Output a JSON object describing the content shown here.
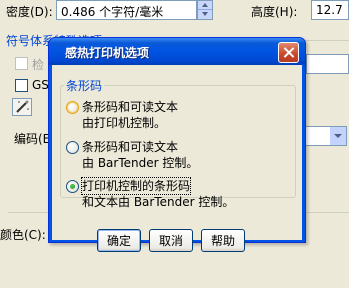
{
  "background": {
    "density_label": "密度(D):",
    "density_value": "0.486 个字符/毫米",
    "height_label": "高度(H):",
    "height_value": "12.7",
    "group_title": "符号体系特殊选项",
    "check1_label": "检",
    "check2_label": "GS",
    "encoding_label": "编码(E",
    "color_label": "颜色(C):"
  },
  "dialog": {
    "title": "感热打印机选项",
    "group_title": "条形码",
    "options": [
      {
        "line1": "条形码和可读文本",
        "line2": "由打印机控制。",
        "selected": false
      },
      {
        "line1": "条形码和可读文本",
        "line2": "由 BarTender 控制。",
        "selected": false
      },
      {
        "line1": "打印机控制的条形码",
        "line2": "和文本由 BarTender 控制。",
        "selected": true
      }
    ],
    "ok_label": "确定",
    "cancel_label": "取消",
    "help_label": "帮助"
  }
}
